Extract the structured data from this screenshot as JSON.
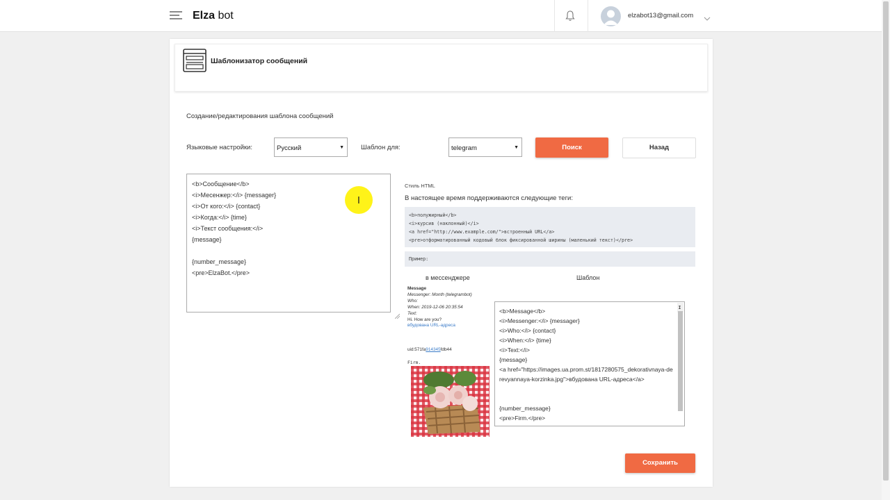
{
  "topbar": {
    "brand_bold": "Elza",
    "brand_light": "bot",
    "user_email": "elzabot13@gmail.com"
  },
  "page": {
    "title": "Шаблонизатор сообщений",
    "subtitle": "Создание/редактирования шаблона сообщений"
  },
  "form": {
    "language_label": "Языковые настройки:",
    "language_value": "Русский",
    "template_for_label": "Шаблон для:",
    "template_for_value": "telegram",
    "search_button": "Поиск",
    "back_button": "Назад",
    "save_button": "Сохранить"
  },
  "editor": {
    "lines": [
      "<b>Сообщение</b>",
      "<i>Месенжер:</i> {messager}",
      "<i>От кого:</i> {contact}",
      "<i>Когда:</i> {time}",
      "<i>Текст сообщения:</i>",
      "{message}",
      "",
      "{number_message}",
      "<pre>ElzaBot.</pre>"
    ]
  },
  "help": {
    "style_label": "Стиль HTML",
    "intro": "В настоящее время поддерживаются следующие теги:",
    "code_lines": [
      "<b>полужирный</b>",
      "<i>курсив (наклонный)</i>",
      "<a href=\"http://www.example.com/\">встроенный URL</a>",
      "<pre>отформатированный кодовый блок фиксированной ширины (маленький текст)</pre>"
    ],
    "example_label": "Пример:",
    "col_messenger": "в мессенджере",
    "col_template": "Шаблон"
  },
  "preview": {
    "title": "Message",
    "messenger": "Messenger: Month  (telegrambot)",
    "who": "Who:",
    "when": "When: 2019-12-06 20:35:54",
    "text": "Text:",
    "message": "Hi. How are you?",
    "link": "вбудована URL-адреса",
    "uid_prefix": "uid:571fa",
    "uid_link": "914345",
    "uid_suffix": "fdb44",
    "firm": "Firm."
  },
  "template_example": {
    "lines": [
      "<b>Message</b>",
      "<i>Messenger:</i> {messager}",
      "<i>Who:</i> {contact}",
      "<i>When:</i> {time}",
      "<i>Text:</i>",
      "{message}"
    ],
    "link_line": "<a href=\"https://images.ua.prom.st/1817280575_dekorativnaya-derevyannaya-korzinka.jpg\">вбудована URL-адреса</a>",
    "tail_lines": [
      "",
      "",
      "{number_message}",
      "<pre>Firm.</pre>"
    ]
  },
  "colors": {
    "accent": "#f06a43",
    "code_bg": "#e9ecf1",
    "link": "#3a7bc8"
  }
}
